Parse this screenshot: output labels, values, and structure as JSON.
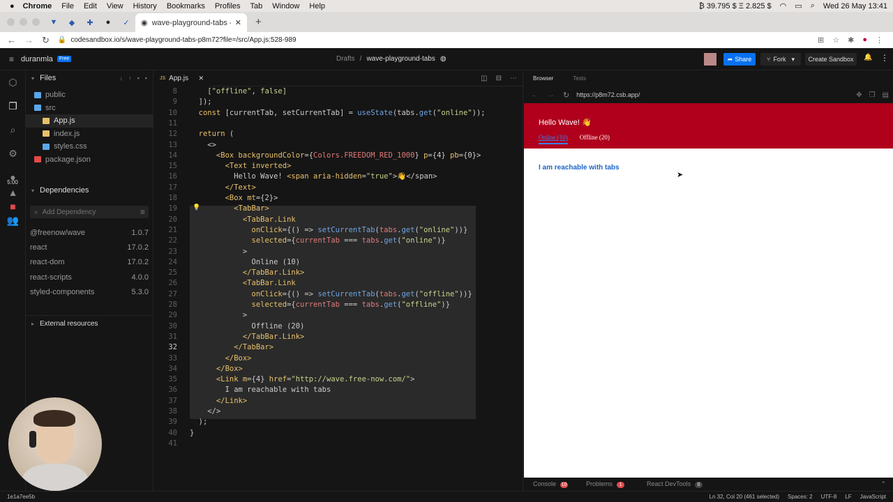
{
  "macbar": {
    "apple": "",
    "app": "Chrome",
    "menus": [
      "File",
      "Edit",
      "View",
      "History",
      "Bookmarks",
      "Profiles",
      "Tab",
      "Window",
      "Help"
    ],
    "crypto": "₿ 39.795 $ Ξ 2.825 $",
    "datetime": "Wed 26 May  13:41"
  },
  "browser": {
    "tab_title": "wave-playground-tabs - Code",
    "url": "codesandbox.io/s/wave-playground-tabs-p8m72?file=/src/App.js:528-989"
  },
  "csb": {
    "user": "duranmla",
    "plan": "Free",
    "breadcrumb_drafts": "Drafts",
    "breadcrumb_sep": "/",
    "sandbox_name": "wave-playground-tabs",
    "share": "Share",
    "fork": "Fork",
    "create": "Create Sandbox"
  },
  "sidebar": {
    "files_title": "Files",
    "files": [
      {
        "name": "public",
        "type": "folder"
      },
      {
        "name": "src",
        "type": "folder"
      },
      {
        "name": "App.js",
        "type": "js"
      },
      {
        "name": "index.js",
        "type": "js"
      },
      {
        "name": "styles.css",
        "type": "css"
      },
      {
        "name": "package.json",
        "type": "json"
      }
    ],
    "deps_title": "Dependencies",
    "add_dep_placeholder": "Add Dependency",
    "deps": [
      {
        "name": "@freenow/wave",
        "version": "1.0.7"
      },
      {
        "name": "react",
        "version": "17.0.2"
      },
      {
        "name": "react-dom",
        "version": "17.0.2"
      },
      {
        "name": "react-scripts",
        "version": "4.0.0"
      },
      {
        "name": "styled-components",
        "version": "5.3.0"
      }
    ],
    "external": "External resources"
  },
  "activity": {
    "timer": "5:00"
  },
  "editor": {
    "tab": "App.js",
    "lines": [
      [
        "8",
        [
          [
            "s",
            "    [\"offline\", false]"
          ]
        ]
      ],
      [
        "9",
        [
          [
            "p",
            "  ]);"
          ]
        ]
      ],
      [
        "10",
        [
          [
            "k",
            "  const "
          ],
          [
            "p",
            "[currentTab, setCurrentTab] = "
          ],
          [
            "f",
            "useState"
          ],
          [
            "p",
            "(tabs."
          ],
          [
            "f",
            "get"
          ],
          [
            "p",
            "("
          ],
          [
            "s",
            "\"online\""
          ],
          [
            "p",
            "));"
          ]
        ]
      ],
      [
        "11",
        [
          [
            "p",
            ""
          ]
        ]
      ],
      [
        "12",
        [
          [
            "k",
            "  return "
          ],
          [
            "p",
            "("
          ]
        ]
      ],
      [
        "13",
        [
          [
            "p",
            "    <>"
          ]
        ]
      ],
      [
        "14",
        [
          [
            "tag",
            "      <Box "
          ],
          [
            "at",
            "backgroundColor"
          ],
          [
            "p",
            "={"
          ],
          [
            "v",
            "Colors.FREEDOM_RED_1000"
          ],
          [
            "p",
            "} "
          ],
          [
            "at",
            "p"
          ],
          [
            "p",
            "={4} "
          ],
          [
            "at",
            "pb"
          ],
          [
            "p",
            "={0}>"
          ]
        ]
      ],
      [
        "15",
        [
          [
            "tag",
            "        <Text "
          ],
          [
            "at",
            "inverted"
          ],
          [
            "tag",
            ">"
          ]
        ]
      ],
      [
        "16",
        [
          [
            "p",
            "          Hello Wave! "
          ],
          [
            "tag",
            "<span "
          ],
          [
            "at",
            "aria-hidden"
          ],
          [
            "p",
            "="
          ],
          [
            "s",
            "\"true\""
          ],
          [
            "p",
            ">👋</span>"
          ]
        ]
      ],
      [
        "17",
        [
          [
            "tag",
            "        </Text>"
          ]
        ]
      ],
      [
        "18",
        [
          [
            "tag",
            "        <Box "
          ],
          [
            "at",
            "mt"
          ],
          [
            "p",
            "={2}>"
          ]
        ]
      ],
      [
        "19",
        [
          [
            "tag",
            "          <TabBar>"
          ]
        ]
      ],
      [
        "20",
        [
          [
            "tag",
            "            <TabBar.Link"
          ]
        ]
      ],
      [
        "21",
        [
          [
            "at",
            "              onClick"
          ],
          [
            "p",
            "={() => "
          ],
          [
            "f",
            "setCurrentTab"
          ],
          [
            "p",
            "("
          ],
          [
            "v",
            "tabs"
          ],
          [
            "p",
            "."
          ],
          [
            "f",
            "get"
          ],
          [
            "p",
            "("
          ],
          [
            "s",
            "\"online\""
          ],
          [
            "p",
            "))}"
          ]
        ]
      ],
      [
        "22",
        [
          [
            "at",
            "              selected"
          ],
          [
            "p",
            "={"
          ],
          [
            "v",
            "currentTab"
          ],
          [
            "p",
            " === "
          ],
          [
            "v",
            "tabs"
          ],
          [
            "p",
            "."
          ],
          [
            "f",
            "get"
          ],
          [
            "p",
            "("
          ],
          [
            "s",
            "\"online\""
          ],
          [
            "p",
            ")}"
          ]
        ]
      ],
      [
        "23",
        [
          [
            "p",
            "            >"
          ]
        ]
      ],
      [
        "24",
        [
          [
            "p",
            "              Online (10)"
          ]
        ]
      ],
      [
        "25",
        [
          [
            "tag",
            "            </TabBar.Link>"
          ]
        ]
      ],
      [
        "26",
        [
          [
            "tag",
            "            <TabBar.Link"
          ]
        ]
      ],
      [
        "27",
        [
          [
            "at",
            "              onClick"
          ],
          [
            "p",
            "={() => "
          ],
          [
            "f",
            "setCurrentTab"
          ],
          [
            "p",
            "("
          ],
          [
            "v",
            "tabs"
          ],
          [
            "p",
            "."
          ],
          [
            "f",
            "get"
          ],
          [
            "p",
            "("
          ],
          [
            "s",
            "\"offline\""
          ],
          [
            "p",
            "))}"
          ]
        ]
      ],
      [
        "28",
        [
          [
            "at",
            "              selected"
          ],
          [
            "p",
            "={"
          ],
          [
            "v",
            "currentTab"
          ],
          [
            "p",
            " === "
          ],
          [
            "v",
            "tabs"
          ],
          [
            "p",
            "."
          ],
          [
            "f",
            "get"
          ],
          [
            "p",
            "("
          ],
          [
            "s",
            "\"offline\""
          ],
          [
            "p",
            ")}"
          ]
        ]
      ],
      [
        "29",
        [
          [
            "p",
            "            >"
          ]
        ]
      ],
      [
        "30",
        [
          [
            "p",
            "              Offline (20)"
          ]
        ]
      ],
      [
        "31",
        [
          [
            "tag",
            "            </TabBar.Link>"
          ]
        ]
      ],
      [
        "32",
        [
          [
            "tag",
            "          </TabBar>"
          ]
        ]
      ],
      [
        "33",
        [
          [
            "tag",
            "        </Box>"
          ]
        ]
      ],
      [
        "34",
        [
          [
            "tag",
            "      </Box>"
          ]
        ]
      ],
      [
        "35",
        [
          [
            "tag",
            "      <Link "
          ],
          [
            "at",
            "m"
          ],
          [
            "p",
            "={4} "
          ],
          [
            "at",
            "href"
          ],
          [
            "p",
            "="
          ],
          [
            "s",
            "\"http://wave.free-now.com/\""
          ],
          [
            "p",
            ">"
          ]
        ]
      ],
      [
        "36",
        [
          [
            "p",
            "        I am reachable with tabs"
          ]
        ]
      ],
      [
        "37",
        [
          [
            "tag",
            "      </Link>"
          ]
        ]
      ],
      [
        "38",
        [
          [
            "p",
            "    </>"
          ]
        ]
      ],
      [
        "39",
        [
          [
            "p",
            "  );"
          ]
        ]
      ],
      [
        "40",
        [
          [
            "p",
            "}"
          ]
        ]
      ],
      [
        "41",
        [
          [
            "p",
            ""
          ]
        ]
      ]
    ]
  },
  "preview": {
    "tab_browser": "Browser",
    "tab_tests": "Tests",
    "url": "https://p8m72.csb.app/",
    "hello": "Hello Wave! 👋",
    "tab_online": "Online (10)",
    "tab_offline": "Offline (20)",
    "link": "I am reachable with tabs",
    "header_color": "#b0001c",
    "link_color": "#1d65c9"
  },
  "bottom": {
    "console": "Console",
    "console_count": "10",
    "problems": "Problems",
    "problems_count": "1",
    "devtools": "React DevTools",
    "devtools_count": "0"
  },
  "status": {
    "hash": "1e1a7ee5b",
    "position": "Ln 32, Col 20 (461 selected)",
    "spaces": "Spaces: 2",
    "encoding": "UTF-8",
    "eol": "LF",
    "language": "JavaScript"
  }
}
